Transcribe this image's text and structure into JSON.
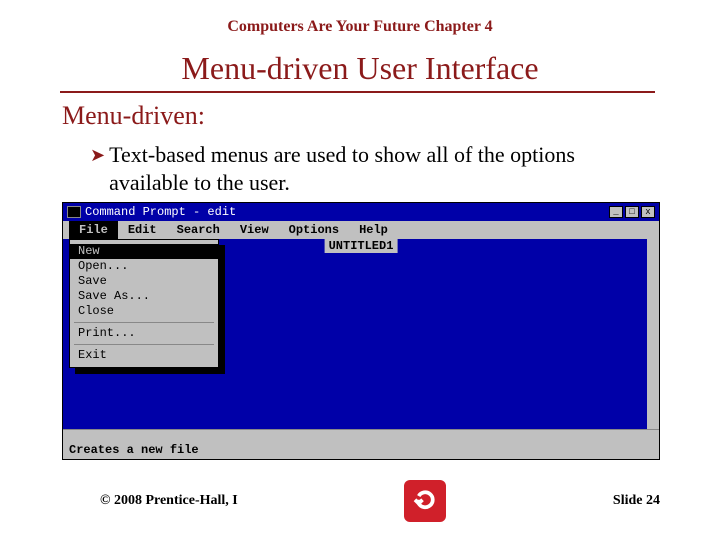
{
  "header": {
    "book_title": "Computers Are Your Future  Chapter 4"
  },
  "slide": {
    "title": "Menu-driven User Interface",
    "subhead": "Menu-driven:",
    "bullet": "Text-based menus are used to show all of the options available to the user."
  },
  "cmd": {
    "title": "Command Prompt - edit",
    "menubar": {
      "file": "File",
      "edit": "Edit",
      "search": "Search",
      "view": "View",
      "options": "Options",
      "help": "Help"
    },
    "filename": "UNTITLED1",
    "dropdown": {
      "new": "New",
      "open": "Open...",
      "save": "Save",
      "saveas": "Save As...",
      "close": "Close",
      "print": "Print...",
      "exit": "Exit"
    },
    "status": "Creates a new file",
    "btns": {
      "min": "_",
      "max": "□",
      "close": "x"
    }
  },
  "footer": {
    "copyright": "© 2008 Prentice-Hall, I",
    "slide_num": "Slide 24"
  }
}
